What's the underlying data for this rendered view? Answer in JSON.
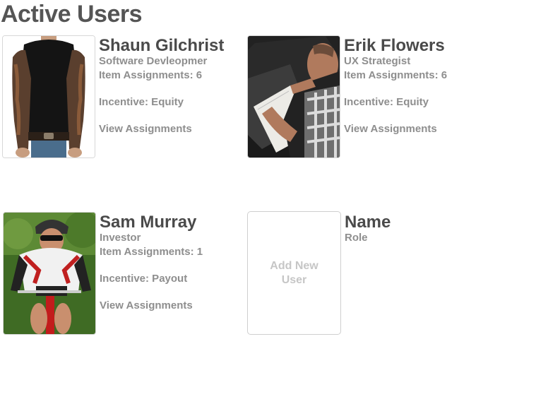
{
  "page": {
    "title": "Active Users"
  },
  "users": [
    {
      "name": "Shaun Gilchrist",
      "role": "Software Devleopmer",
      "assignments": "Item Assignments: 6",
      "incentive": "Incentive: Equity",
      "view_link": "View Assignments"
    },
    {
      "name": "Erik Flowers",
      "role": "UX Strategist",
      "assignments": "Item Assignments: 6",
      "incentive": "Incentive: Equity",
      "view_link": "View Assignments"
    },
    {
      "name": "Sam Murray",
      "role": "Investor",
      "assignments": "Item Assignments: 1",
      "incentive": "Incentive: Payout",
      "view_link": "View Assignments"
    }
  ],
  "new_user": {
    "button_label": "Add New User",
    "name_placeholder": "Name",
    "role_placeholder": "Role"
  },
  "colors": {
    "heading": "#555555",
    "name_text": "#4a4a4a",
    "detail_text": "#8e8e8e",
    "add_text": "#c6c6c6",
    "card_border": "#cfcfcf"
  }
}
